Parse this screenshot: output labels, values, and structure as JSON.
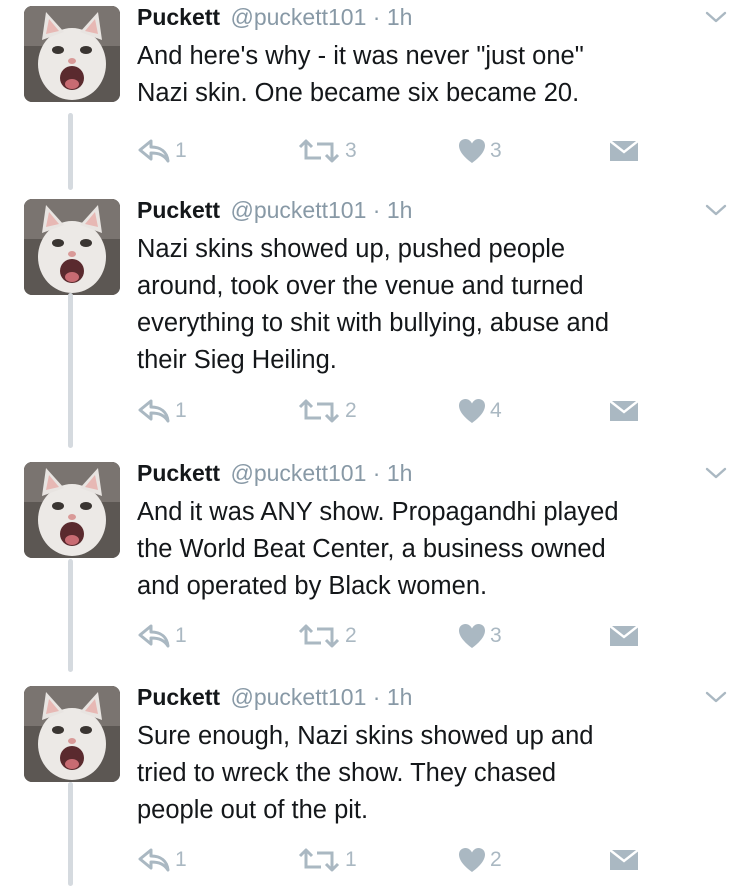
{
  "tweets": [
    {
      "name": "Puckett",
      "handle": "@puckett101",
      "separator": "·",
      "time": "1h",
      "text_lines": [
        "And here's why - it was never \"just one\"",
        "Nazi skin. One became six became 20."
      ],
      "replies": "1",
      "retweets": "3",
      "likes": "3"
    },
    {
      "name": "Puckett",
      "handle": "@puckett101",
      "separator": "·",
      "time": "1h",
      "text_lines": [
        "Nazi skins showed up, pushed people",
        "around, took over the venue and turned",
        "everything to shit with bullying, abuse and",
        "their Sieg Heiling."
      ],
      "replies": "1",
      "retweets": "2",
      "likes": "4"
    },
    {
      "name": "Puckett",
      "handle": "@puckett101",
      "separator": "·",
      "time": "1h",
      "text_lines": [
        "And it was ANY show. Propagandhi played",
        "the World Beat Center, a business owned",
        "and operated by Black women."
      ],
      "replies": "1",
      "retweets": "2",
      "likes": "3"
    },
    {
      "name": "Puckett",
      "handle": "@puckett101",
      "separator": "·",
      "time": "1h",
      "text_lines": [
        "Sure enough, Nazi skins showed up and",
        "tried to wreck the show. They chased",
        "people out of the pit."
      ],
      "replies": "1",
      "retweets": "1",
      "likes": "2"
    }
  ],
  "icons": {
    "reply": "reply-icon",
    "retweet": "retweet-icon",
    "like": "heart-icon",
    "dm": "envelope-icon",
    "menu": "chevron-down-icon"
  },
  "colors": {
    "name": "#14171a",
    "meta": "#8899a6",
    "action_icon": "#aab8c2",
    "thread_line": "#d5dadf"
  }
}
